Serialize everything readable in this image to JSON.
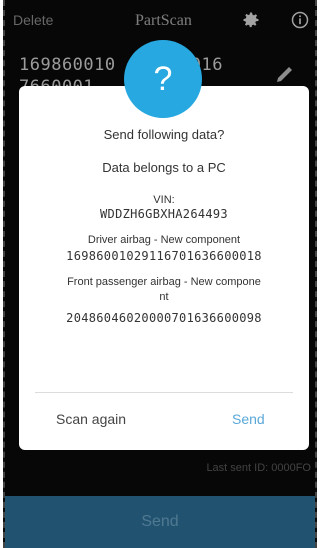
{
  "header": {
    "delete_label": "Delete",
    "title": "PartScan",
    "settings_icon": "gear-icon",
    "info_icon": "info-icon"
  },
  "background": {
    "barcode_lines": "169860010",
    "barcode_tail": "7016",
    "barcode_line2": "7660001",
    "last_sent": "Last sent ID: 0000FO",
    "send_button": "Send"
  },
  "dialog": {
    "icon": "question-icon",
    "icon_glyph": "?",
    "accent_color": "#27a8e0",
    "question": "Send following data?",
    "belongs": "Data belongs to a PC",
    "vin_label": "VIN:",
    "vin_value": "WDDZH6GBXHA264493",
    "driver_label": "Driver airbag - New component",
    "driver_value": "1698600102911670163660001​8",
    "passenger_label_1": "Front passenger airbag - New compone",
    "passenger_label_2": "nt",
    "passenger_value": "20486046020000701636600098",
    "scan_again": "Scan again",
    "send": "Send"
  }
}
